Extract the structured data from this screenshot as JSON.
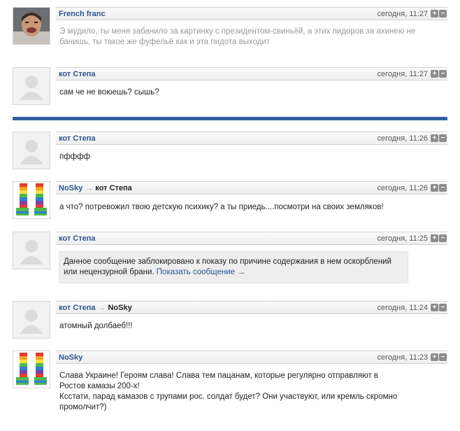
{
  "comments": [
    {
      "author": "French franc",
      "reply_to": "",
      "time": "сегодня, 11:27",
      "avatar": "person-photo",
      "text": "Э мудило, ты меня забанило за картинку с президентом-свиньёй, а этих пидоров за ахинею не банишь, ты такое же фуфельё как и эта пидота выходит"
    },
    {
      "author": "кот Степа",
      "reply_to": "",
      "time": "сегодня, 11:27",
      "avatar": "default-silhouette",
      "text": "сам че не воюешь? сышь?"
    },
    {
      "author": "кот Степа",
      "reply_to": "",
      "time": "сегодня, 11:26",
      "avatar": "default-silhouette",
      "text": "пфффф"
    },
    {
      "author": "NoSky",
      "reply_to": "кот Степа",
      "time": "сегодня, 11:26",
      "avatar": "striped-socks",
      "text": "а что? потревожил твою детскую психику? а ты приедь....посмотри на своих земляков!"
    },
    {
      "author": "кот Степа",
      "reply_to": "",
      "time": "сегодня, 11:25",
      "avatar": "default-silhouette",
      "blocked_text": "Данное сообщение заблокировано к показу по причине содержания в нем оскорблений или нецензурной брани.",
      "show_link": "Показать сообщение →"
    },
    {
      "author": "кот Степа",
      "reply_to": "NoSky",
      "time": "сегодня, 11:24",
      "avatar": "default-silhouette",
      "text": "атомный долбаеб!!!"
    },
    {
      "author": "NoSky",
      "reply_to": "",
      "time": "сегодня, 11:23",
      "avatar": "striped-socks",
      "text": "Слава Украине! Героям слава! Слава тем пацанам, которые регулярно отправляют в Ростов камазы 200-х!\nКсстати, парад камазов с трупами рос. солдат будет? Они участвуют, или кремль скромно промолчит?)"
    }
  ],
  "colors": {
    "author": "#2c5590",
    "divider": "#2f5f9e",
    "faded_text": "#9a9a9a"
  },
  "icons": {
    "plus": "+",
    "minus": "−",
    "arrow": "→"
  }
}
